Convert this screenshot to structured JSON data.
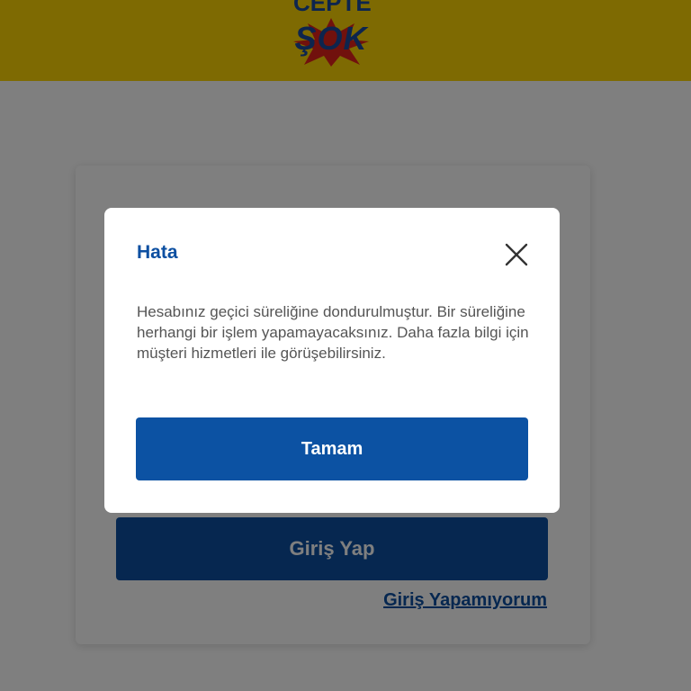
{
  "header": {
    "logo_top": "CEPTE",
    "logo_main": "ŞOK",
    "brand_color": "#fcd504"
  },
  "login": {
    "login_button_label": "Giriş Yap",
    "cant_login_label": "Giriş Yapamıyorum"
  },
  "dialog": {
    "title": "Hata",
    "message": "Hesabınız geçici süreliğine dondurulmuştur. Bir süreliğine herhangi bir işlem yapamayacaksınız. Daha fazla bilgi için müşteri hizmetleri ile görüşebilirsiniz.",
    "ok_label": "Tamam",
    "close_icon": "close-icon"
  },
  "colors": {
    "accent": "#0c4fa1",
    "overlay": "rgba(0,0,0,0.5)"
  }
}
